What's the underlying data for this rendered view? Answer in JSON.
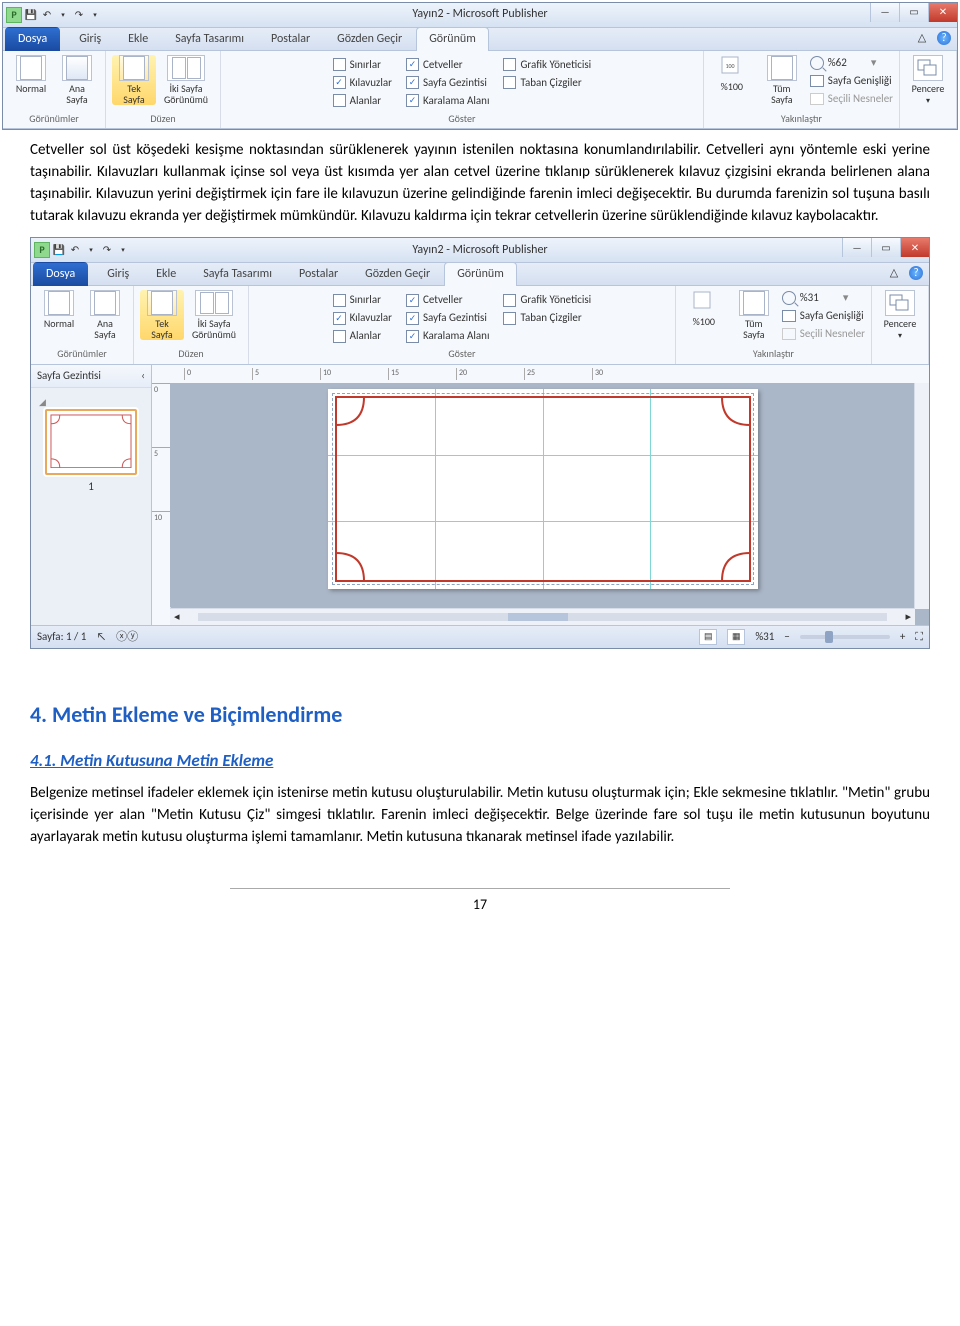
{
  "app": {
    "title": "Yayın2  -  Microsoft Publisher",
    "qat_save": "💾",
    "qat_undo": "↶",
    "qat_redo": "↷",
    "qat_more": "▾",
    "win_min": "—",
    "win_max": "▭",
    "win_close": "✕",
    "collapse": "△",
    "help": "?"
  },
  "tabs": {
    "file": "Dosya",
    "t0": "Giriş",
    "t1": "Ekle",
    "t2": "Sayfa Tasarımı",
    "t3": "Postalar",
    "t4": "Gözden Geçir",
    "t5": "Görünüm"
  },
  "ribbon": {
    "views": {
      "normal": "Normal",
      "master": "Ana\nSayfa",
      "group": "Görünümler"
    },
    "layout": {
      "single": "Tek\nSayfa",
      "spread": "İki Sayfa\nGörünümü",
      "group": "Düzen"
    },
    "show": {
      "boundaries": "Sınırlar",
      "guides": "Kılavuzlar",
      "fields": "Alanlar",
      "rulers": "Cetveller",
      "pagenav": "Sayfa Gezintisi",
      "scratch": "Karalama Alanı",
      "gfxmgr": "Grafik Yöneticisi",
      "baselines": "Taban Çizgiler",
      "group": "Göster"
    },
    "zoom": {
      "z100": "%100",
      "whole": "Tüm\nSayfa",
      "pct1": "%62",
      "pct2": "%31",
      "pagewidth": "Sayfa Genişliği",
      "selected": "Seçili Nesneler",
      "group": "Yakınlaştır"
    },
    "window": {
      "label": "Pencere",
      "drop": "▾"
    }
  },
  "status": {
    "nav_title": "Sayfa Gezintisi",
    "nav_collapse": "‹",
    "thumb_tri": "◢",
    "thumb_num": "1",
    "page": "Sayfa: 1 / 1",
    "cursor": "↖",
    "xy": "ⓧⓨ",
    "zoom": "%31",
    "minus": "−",
    "plus": "+",
    "fit": "⛶"
  },
  "ruler_h": [
    "0",
    "5",
    "10",
    "15",
    "20",
    "25",
    "30"
  ],
  "ruler_v": [
    "0",
    "5",
    "10"
  ],
  "body": {
    "p1": "Cetveller sol üst köşedeki kesişme noktasından sürüklenerek yayının istenilen noktasına konumlandırılabilir. Cetvelleri aynı yöntemle eski yerine taşınabilir. Kılavuzları kullanmak içinse sol veya üst kısımda yer alan cetvel üzerine tıklanıp sürüklenerek kılavuz çizgisini ekranda belirlenen alana taşınabilir. Kılavuzun yerini değiştirmek için fare ile kılavuzun üzerine gelindiğinde farenin imleci değişecektir. Bu durumda farenizin sol tuşuna basılı tutarak kılavuzu ekranda yer değiştirmek mümkündür. Kılavuzu kaldırma için tekrar cetvellerin üzerine sürüklendiğinde kılavuz kaybolacaktır.",
    "h2": "4. Metin Ekleme ve Biçimlendirme",
    "h3": "4.1. Metin Kutusuna Metin Ekleme",
    "p2": "Belgenize metinsel ifadeler eklemek için istenirse metin kutusu oluşturulabilir. Metin kutusu oluşturmak için; Ekle sekmesine tıklatılır. \"Metin\" grubu içerisinde yer alan \"Metin Kutusu Çiz\" simgesi tıklatılır. Farenin imleci değişecektir. Belge üzerinde fare sol tuşu ile metin kutusunun boyutunu ayarlayarak metin kutusu oluşturma işlemi tamamlanır. Metin kutusuna tıkanarak metinsel ifade yazılabilir."
  },
  "footer": {
    "page": "17"
  }
}
